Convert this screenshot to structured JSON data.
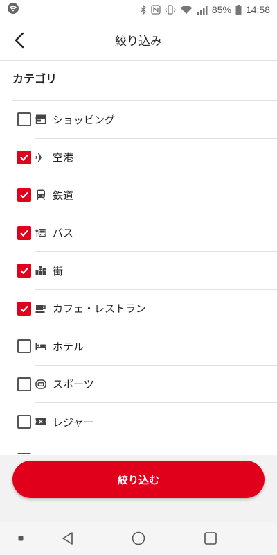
{
  "status_bar": {
    "battery": "85%",
    "time": "14:58"
  },
  "header": {
    "title": "絞り込み"
  },
  "section": {
    "title": "カテゴリ"
  },
  "categories": [
    {
      "label": "ショッピング",
      "checked": false,
      "icon": "store-icon"
    },
    {
      "label": "空港",
      "checked": true,
      "icon": "airplane-icon"
    },
    {
      "label": "鉄道",
      "checked": true,
      "icon": "train-icon"
    },
    {
      "label": "バス",
      "checked": true,
      "icon": "bus-icon"
    },
    {
      "label": "街",
      "checked": true,
      "icon": "city-icon"
    },
    {
      "label": "カフェ・レストラン",
      "checked": true,
      "icon": "coffee-icon"
    },
    {
      "label": "ホテル",
      "checked": false,
      "icon": "bed-icon"
    },
    {
      "label": "スポーツ",
      "checked": false,
      "icon": "sports-icon"
    },
    {
      "label": "レジャー",
      "checked": false,
      "icon": "ticket-icon"
    },
    {
      "label": "",
      "checked": false,
      "icon": ""
    }
  ],
  "apply_button": {
    "label": "絞り込む"
  },
  "colors": {
    "accent": "#e0001b",
    "divider": "#e0e0e0",
    "bottom_panel": "#f2f2f2"
  }
}
